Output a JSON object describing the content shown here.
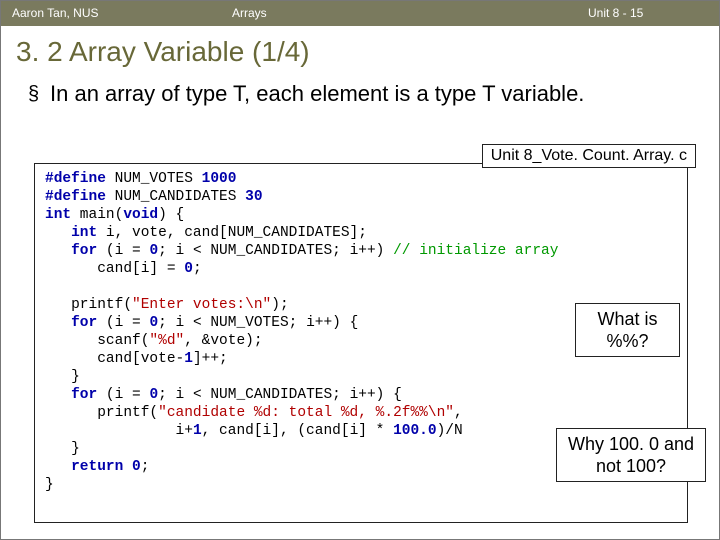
{
  "header": {
    "left": "Aaron Tan, NUS",
    "mid": "Arrays",
    "right": "Unit 8 - 15"
  },
  "title": "3. 2 Array Variable (1/4)",
  "bullet_text": "In an array of type T, each element is a type T variable.",
  "filename": "Unit 8_Vote. Count. Array. c",
  "callout1_l1": "What is",
  "callout1_l2": "%%?",
  "callout2_l1": "Why 100. 0 and",
  "callout2_l2": "not 100?",
  "code": {
    "d1a": "#define",
    "d1b": " NUM_VOTES ",
    "d1c": "1000",
    "d2a": "#define",
    "d2b": " NUM_CANDIDATES ",
    "d2c": "30",
    "l3a": "int",
    "l3b": " main(",
    "l3c": "void",
    "l3d": ") {",
    "l4a": "   ",
    "l4b": "int",
    "l4c": " i, vote, cand[NUM_CANDIDATES];",
    "l5a": "   ",
    "l5b": "for",
    "l5c": " (i = ",
    "l5d": "0",
    "l5e": "; i < NUM_CANDIDATES; i++) ",
    "l5f": "// initialize array",
    "l6a": "      cand[i] = ",
    "l6b": "0",
    "l6c": ";",
    "blank": " ",
    "l8a": "   printf(",
    "l8b": "\"Enter votes:\\n\"",
    "l8c": ");",
    "l9a": "   ",
    "l9b": "for",
    "l9c": " (i = ",
    "l9d": "0",
    "l9e": "; i < NUM_VOTES; i++) {",
    "l10a": "      scanf(",
    "l10b": "\"%d\"",
    "l10c": ", &vote);",
    "l11a": "      cand[vote-",
    "l11b": "1",
    "l11c": "]++;",
    "l12": "   }",
    "l13a": "   ",
    "l13b": "for",
    "l13c": " (i = ",
    "l13d": "0",
    "l13e": "; i < NUM_CANDIDATES; i++) {",
    "l14a": "      printf(",
    "l14b": "\"candidate %d: total %d, %.2f%%\\n\"",
    "l14c": ",",
    "l15a": "               i+",
    "l15b": "1",
    "l15c": ", cand[i], (cand[i] * ",
    "l15d": "100.0",
    "l15e": ")/N",
    "l16": "   }",
    "l17a": "   ",
    "l17b": "return",
    "l17c": " ",
    "l17d": "0",
    "l17e": ";",
    "l18": "}"
  }
}
